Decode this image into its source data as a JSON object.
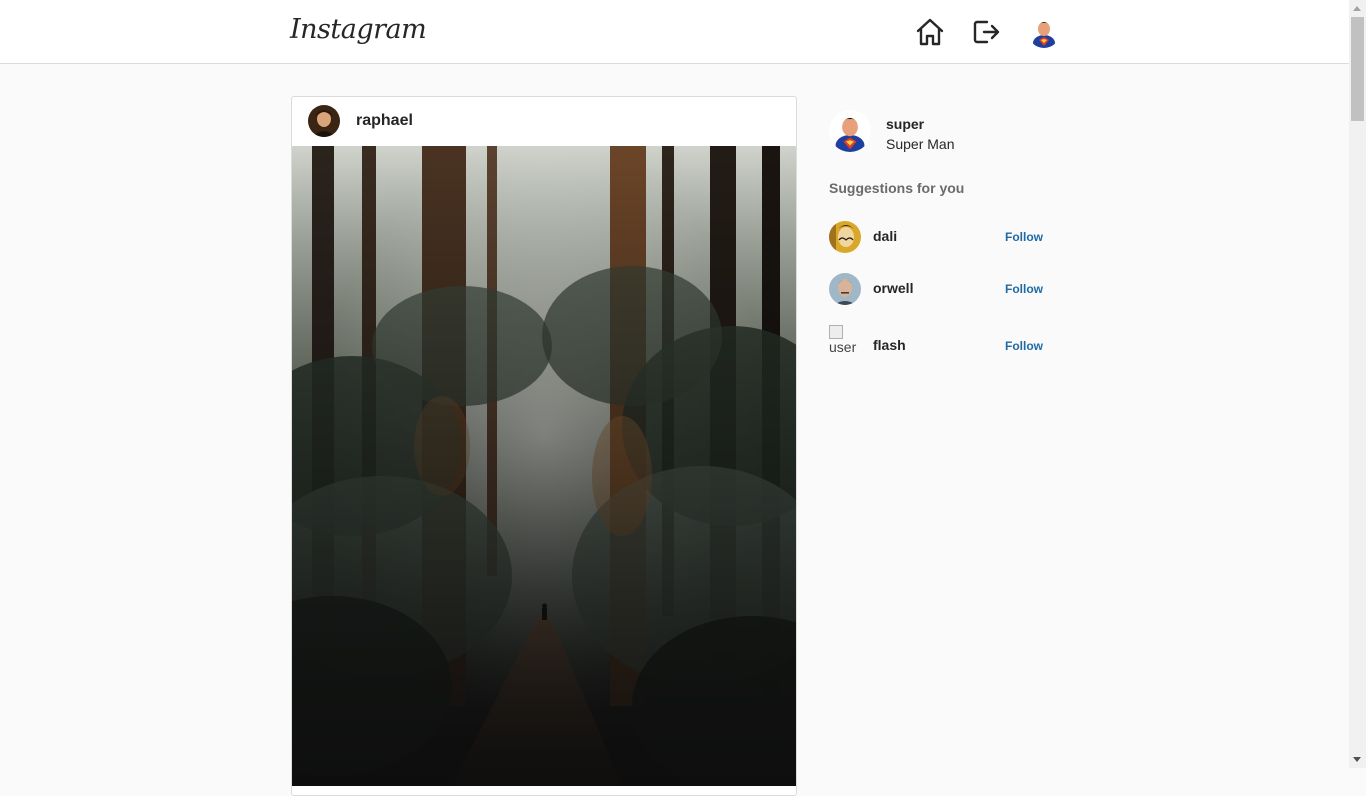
{
  "header": {
    "logo": "Instagram",
    "home_icon": "home-icon",
    "logout_icon": "logout-icon"
  },
  "post": {
    "username": "raphael"
  },
  "sidebar": {
    "me": {
      "username": "super",
      "fullname": "Super Man"
    },
    "suggestions_title": "Suggestions for you",
    "suggestions": [
      {
        "username": "dali",
        "follow_label": "Follow"
      },
      {
        "username": "orwell",
        "follow_label": "Follow"
      },
      {
        "username": "flash",
        "follow_label": "Follow",
        "avatar_alt": "user"
      }
    ]
  },
  "colors": {
    "link_blue": "#1f6aa5",
    "border": "#dbdbdb",
    "background": "#fafafa"
  }
}
